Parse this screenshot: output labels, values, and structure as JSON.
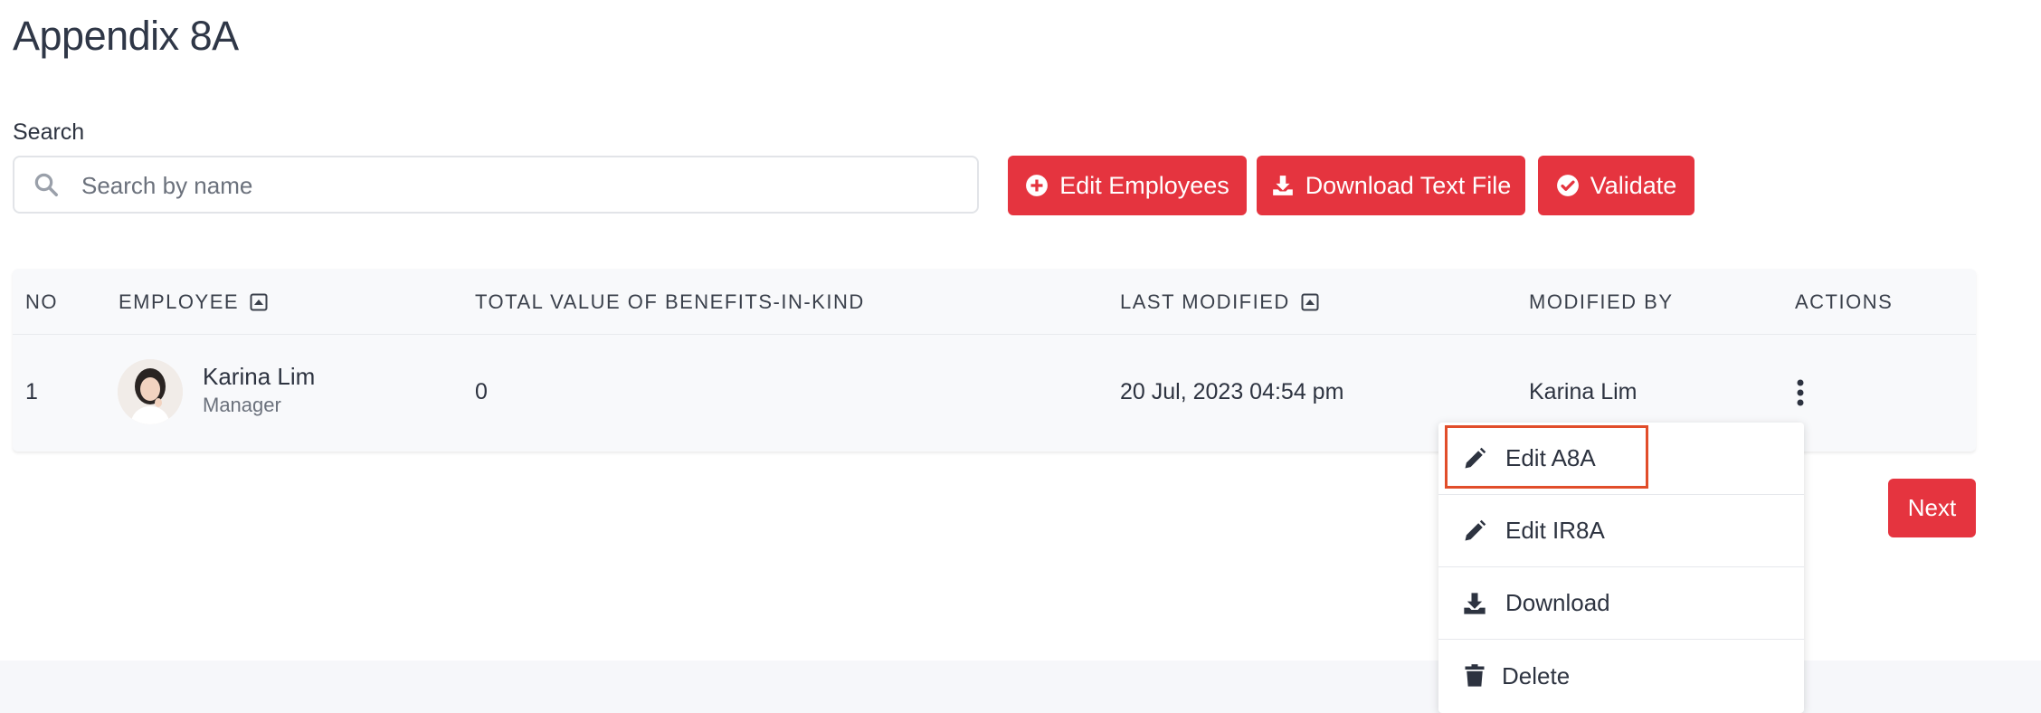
{
  "page": {
    "title": "Appendix 8A"
  },
  "search": {
    "label": "Search",
    "placeholder": "Search by name",
    "value": ""
  },
  "toolbar": {
    "edit_employees": "Edit Employees",
    "download_text_file": "Download Text File",
    "validate": "Validate"
  },
  "table": {
    "headers": {
      "no": "NO",
      "employee": "EMPLOYEE",
      "benefits": "TOTAL VALUE OF BENEFITS-IN-KIND",
      "last_modified": "LAST MODIFIED",
      "modified_by": "MODIFIED BY",
      "actions": "ACTIONS"
    },
    "rows": [
      {
        "no": "1",
        "name": "Karina Lim",
        "role": "Manager",
        "benefits": "0",
        "last_modified": "20 Jul, 2023 04:54 pm",
        "modified_by": "Karina Lim"
      }
    ]
  },
  "pagination": {
    "next": "Next"
  },
  "actions_menu": {
    "items": [
      {
        "label": "Edit A8A",
        "icon": "pencil-icon",
        "highlighted": true
      },
      {
        "label": "Edit IR8A",
        "icon": "pencil-icon"
      },
      {
        "label": "Download",
        "icon": "download-icon"
      },
      {
        "label": "Delete",
        "icon": "trash-icon"
      }
    ]
  },
  "colors": {
    "accent": "#e5343f",
    "highlight": "#e14d2a"
  }
}
